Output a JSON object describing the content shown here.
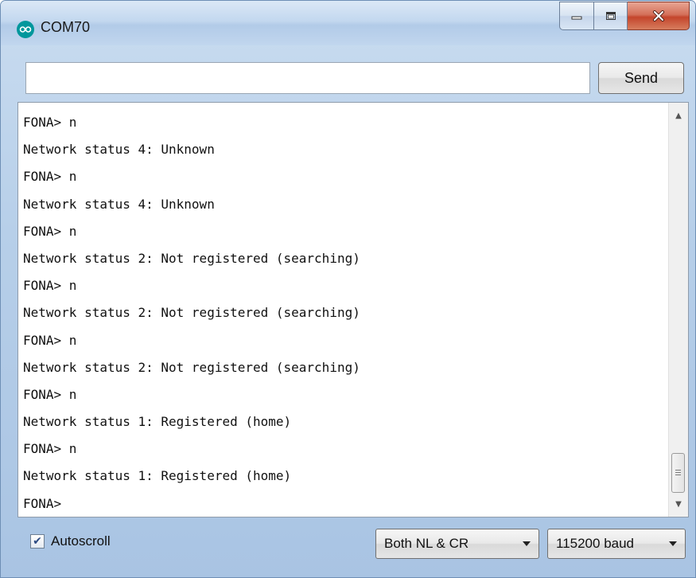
{
  "window": {
    "title": "COM70",
    "icon": "arduino-infinity-icon"
  },
  "caption_buttons": {
    "minimize_icon": "minimize-icon",
    "maximize_icon": "maximize-icon",
    "close_icon": "close-icon",
    "close_color": "#c4452c"
  },
  "send_bar": {
    "input_value": "",
    "send_label": "Send"
  },
  "serial_output": [
    "FONA> n",
    "Network status 4: Unknown",
    "FONA> n",
    "Network status 4: Unknown",
    "FONA> n",
    "Network status 2: Not registered (searching)",
    "FONA> n",
    "Network status 2: Not registered (searching)",
    "FONA> n",
    "Network status 2: Not registered (searching)",
    "FONA> n",
    "Network status 1: Registered (home)",
    "FONA> n",
    "Network status 1: Registered (home)",
    "FONA>"
  ],
  "scroll_position": 0.92,
  "bottom_bar": {
    "autoscroll_label": "Autoscroll",
    "autoscroll_checked": true,
    "line_ending_selected": "Both NL & CR",
    "baud_selected": "115200 baud"
  }
}
